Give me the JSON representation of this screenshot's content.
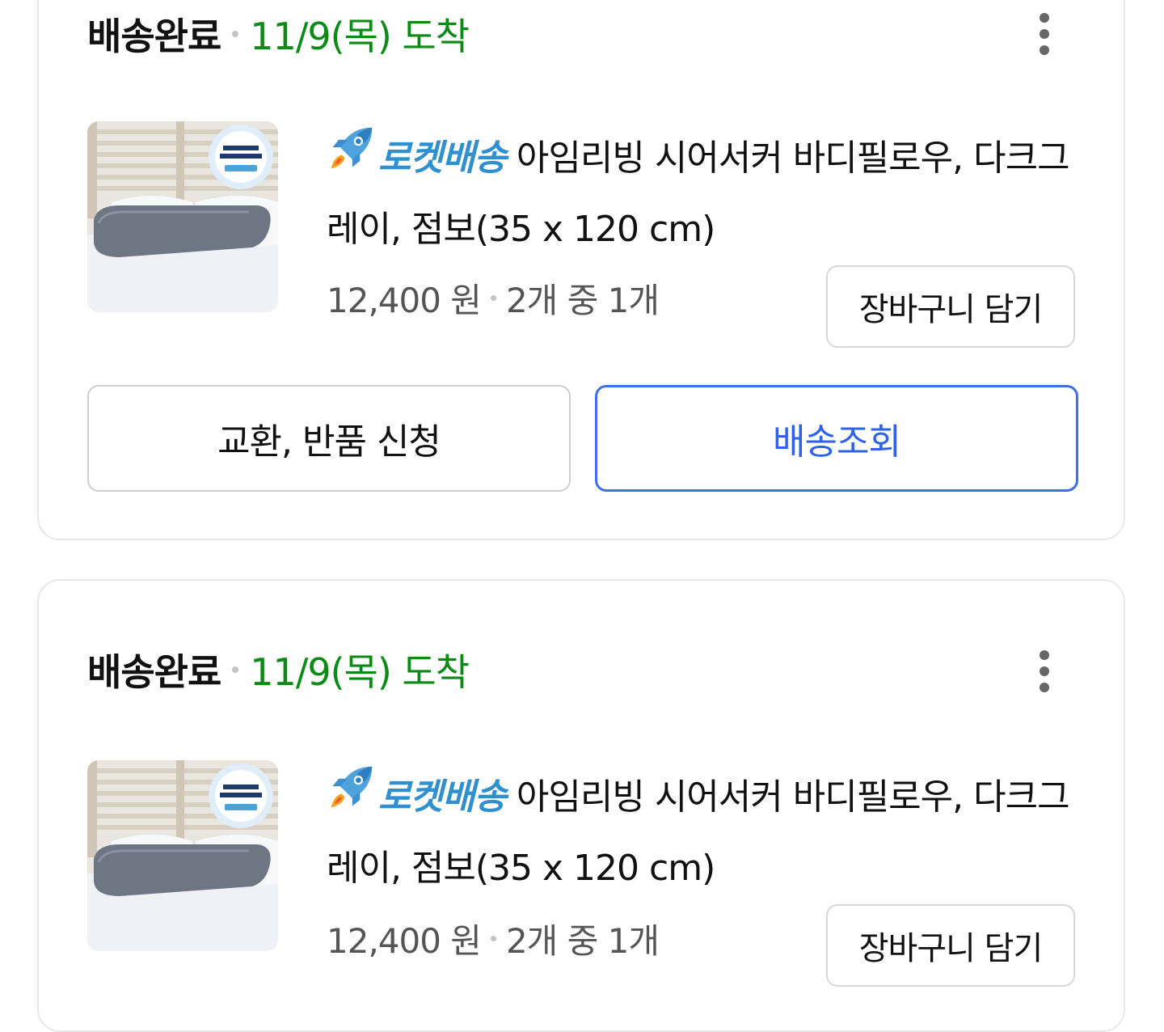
{
  "orders": [
    {
      "status": "배송완료",
      "arrival": "11/9(목) 도착",
      "rocket_label": "로켓배송",
      "product_name": "아임리빙 시어서커 바디필로우, 다크그레이, 점보(35 x 120 cm)",
      "price": "12,400 원",
      "quantity": "2개 중 1개",
      "cart_button": "장바구니 담기",
      "return_button": "교환, 반품 신청",
      "track_button": "배송조회"
    },
    {
      "status": "배송완료",
      "arrival": "11/9(목) 도착",
      "rocket_label": "로켓배송",
      "product_name": "아임리빙 시어서커 바디필로우, 다크그레이, 점보(35 x 120 cm)",
      "price": "12,400 원",
      "quantity": "2개 중 1개",
      "cart_button": "장바구니 담기"
    }
  ],
  "colors": {
    "arrival_green": "#0b8a16",
    "rocket_blue": "#2f8fcf",
    "track_blue": "#3f6fe8"
  },
  "icons": {
    "rocket": "rocket-icon",
    "more": "more-vertical-icon"
  }
}
